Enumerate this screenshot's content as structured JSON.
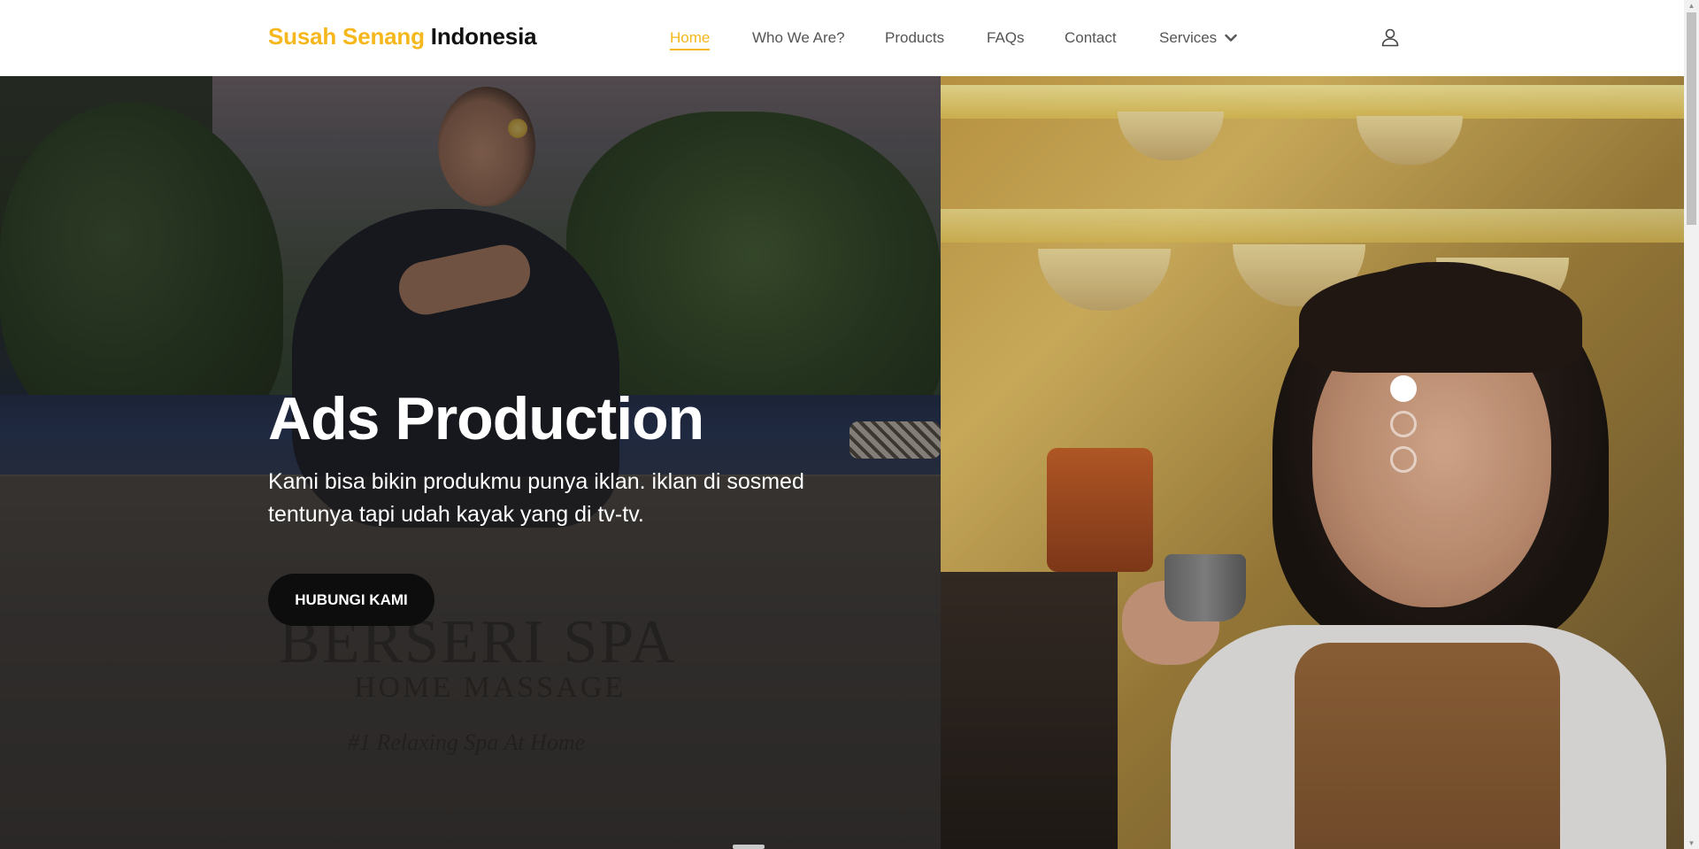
{
  "brand": {
    "accent": "Susah Senang",
    "main": "Indonesia"
  },
  "nav": {
    "items": [
      {
        "label": "Home",
        "active": true
      },
      {
        "label": "Who We Are?"
      },
      {
        "label": "Products"
      },
      {
        "label": "FAQs"
      },
      {
        "label": "Contact"
      },
      {
        "label": "Services",
        "icon": "chevron-down-icon"
      }
    ],
    "user_icon": "user-icon"
  },
  "hero": {
    "title": "Ads Production",
    "description": "Kami bisa bikin produkmu punya iklan. iklan di sosmed tentunya tapi udah kayak yang di tv-tv.",
    "cta_label": "HUBUNGI KAMI",
    "background_logo": {
      "line1": "BERSERI SPA",
      "line2": "HOME MASSAGE",
      "line3": "#1 Relaxing Spa At Home"
    },
    "slides": {
      "count": 3,
      "active_index": 0
    }
  },
  "colors": {
    "accent": "#f5b71b",
    "text_dark": "#111111",
    "nav_text": "#555555",
    "cta_bg": "#0d0d0d"
  }
}
